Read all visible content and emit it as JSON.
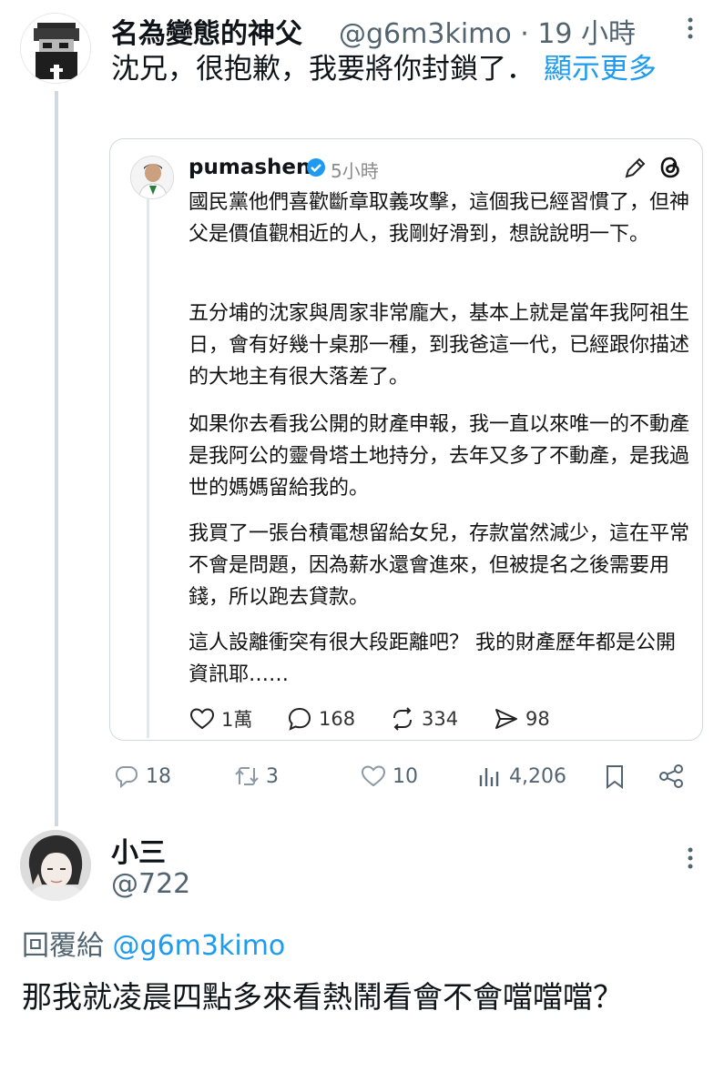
{
  "tweet1": {
    "display_name": "名為變態的神父",
    "meta": "@g6m3kimo · 19 小時",
    "text": "沈兄，很抱歉，我要將你封鎖了．",
    "show_more": "顯示更多",
    "avatar_icon": "pixel-priest-avatar"
  },
  "quoted_card": {
    "name": "pumashen",
    "time": "5小時",
    "verified_icon": "verified-badge-icon",
    "paragraphs": [
      "國民黨他們喜歡斷章取義攻擊，這個我已經習慣了，但神父是價值觀相近的人，我剛好滑到，想說說明一下。",
      "五分埔的沈家與周家非常龐大，基本上就是當年我阿祖生日，會有好幾十桌那一種，到我爸這一代，已經跟你描述的大地主有很大落差了。",
      "如果你去看我公開的財產申報，我一直以來唯一的不動產是我阿公的靈骨塔土地持分，去年又多了不動產，是我過世的媽媽留給我的。",
      "我買了一張台積電想留給女兒，存款當然減少，這在平常不會是問題，因為薪水還會進來，但被提名之後需要用錢，所以跑去貸款。",
      "這人設離衝突有很大段距離吧？ 我的財產歷年都是公開資訊耶……"
    ],
    "actions": {
      "likes": "1萬",
      "replies": "168",
      "reposts": "334",
      "shares": "98"
    }
  },
  "tweet1_actions": {
    "replies": "18",
    "retweets": "3",
    "likes": "10",
    "views": "4,206"
  },
  "tweet3": {
    "display_name": "小三",
    "handle": "@722",
    "reply_to_prefix": "回覆給",
    "reply_to_handle": "@g6m3kimo",
    "text": "那我就凌晨四點多來看熱鬧看會不會噹噹噹？"
  },
  "colors": {
    "link": "#1d9bf0",
    "secondary_text": "#536471",
    "thread_line": "#cfd9de",
    "verified": "#1d9bf0"
  }
}
